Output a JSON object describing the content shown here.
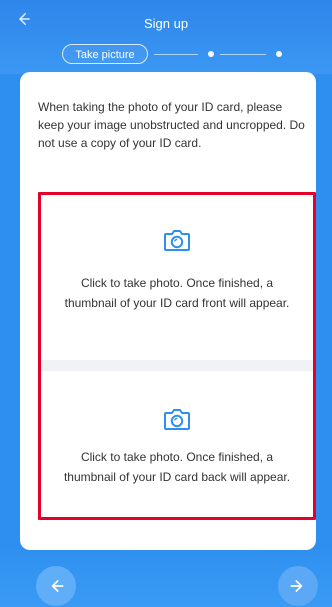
{
  "header": {
    "title": "Sign up",
    "step_label": "Take picture"
  },
  "card": {
    "intro_text": "When taking the photo of your ID card, please keep your image unobstructed and uncropped. Do not use a copy of your ID card.",
    "front": {
      "prompt": "Click to take photo. Once finished, a thumbnail of your ID card front will appear."
    },
    "back": {
      "prompt": "Click to take photo. Once finished, a thumbnail of your ID card back will appear."
    }
  },
  "icons": {
    "back": "arrow-left-icon",
    "camera": "camera-icon",
    "prev": "arrow-left-icon",
    "next": "arrow-right-icon"
  },
  "colors": {
    "primary": "#2f8ff0",
    "highlight": "#e3002b",
    "camera": "#2f8ff0"
  }
}
